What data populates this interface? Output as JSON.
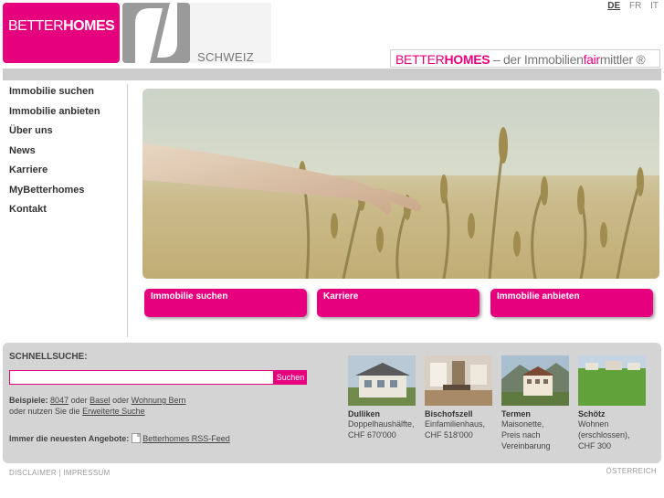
{
  "header": {
    "logo_text_light": "BETTER",
    "logo_text_bold": "HOMES",
    "logo_country": "SCHWEIZ",
    "tagline_light": "BETTER",
    "tagline_bold": "HOMES",
    "tagline_rest": " – der Immobilien",
    "tagline_fair": "fair",
    "tagline_end": "mittler ®"
  },
  "languages": [
    "DE",
    "FR",
    "IT"
  ],
  "active_language": "DE",
  "nav": {
    "items": [
      "Immobilie suchen",
      "Immobilie anbieten",
      "Über uns",
      "News",
      "Karriere",
      "MyBetterhomes",
      "Kontakt"
    ]
  },
  "teasers": [
    "Immobilie suchen",
    "Karriere",
    "Immobilie anbieten"
  ],
  "quicksearch": {
    "title": "SCHNELLSUCHE:",
    "input_value": "",
    "button_label": "Suchen",
    "examples_label": "Beispiele:",
    "example_1": "8047",
    "or_1": " oder ",
    "example_2": "Basel",
    "or_2": " oder ",
    "example_3": "Wohnung Bern",
    "use_prefix": "oder nutzen Sie die ",
    "advanced_link": "Erweiterte Suche",
    "rss_label": "Immer die neuesten Angebote:",
    "rss_link": "Betterhomes RSS-Feed"
  },
  "listings": [
    {
      "place": "Dulliken",
      "desc": [
        "Doppelhaushälfte,",
        "CHF 670'000"
      ]
    },
    {
      "place": "Bischofszell",
      "desc": [
        "Einfamilienhaus,",
        "CHF 518'000"
      ]
    },
    {
      "place": "Termen",
      "desc": [
        "Maisonette,",
        "Preis nach",
        "Vereinbarung"
      ]
    },
    {
      "place": "Schötz",
      "desc": [
        "Wohnen",
        "(erschlossen),",
        "CHF 300"
      ]
    }
  ],
  "footer": {
    "disclaimer": "DISCLAIMER",
    "separator": " | ",
    "impressum": "IMPRESSUM",
    "country_link": "ÖSTERREICH"
  },
  "colors": {
    "brand_magenta": "#e6007e",
    "panel_grey": "#d4d4d4",
    "bar_grey": "#cccccc"
  }
}
